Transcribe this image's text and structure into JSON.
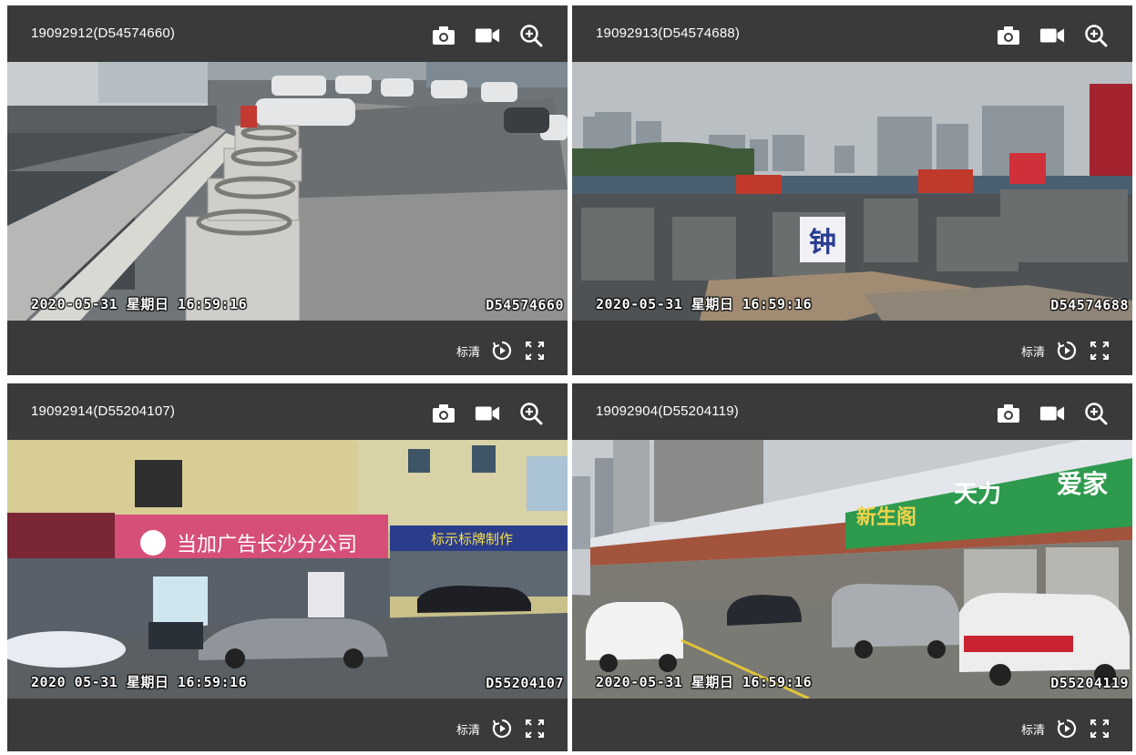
{
  "toolbar": {
    "snapshot_icon": "camera-icon",
    "record_icon": "video-camera-icon",
    "zoom_icon": "zoom-in-icon",
    "play_icon": "play-circle-icon",
    "fullscreen_icon": "fullscreen-icon"
  },
  "cameras": [
    {
      "title": "19092912(D54574660)",
      "osd_date": "2020-05-31 星期日 16:59:16",
      "osd_id": "D54574660",
      "quality": "标清"
    },
    {
      "title": "19092913(D54574688)",
      "osd_date": "2020-05-31 星期日 16:59:16",
      "osd_id": "D54574688",
      "quality": "标清"
    },
    {
      "title": "19092914(D55204107)",
      "osd_date": "2020 05-31 星期日 16:59:16",
      "osd_id": "D55204107",
      "quality": "标清"
    },
    {
      "title": "19092904(D55204119)",
      "osd_date": "2020-05-31 星期日 16:59:16",
      "osd_id": "D55204119",
      "quality": "标清"
    }
  ],
  "signs": {
    "cam1_board": "钟",
    "cam2_sign": "当加广告长沙分公司",
    "cam2_sign2": "标示标牌制作",
    "cam3_sign": "天力",
    "cam3_sign2": "爱家",
    "cam3_sign3": "新生阁"
  },
  "colors": {
    "panel_bg": "#3a3a3a",
    "text": "#ffffff",
    "page_bg": "#ffffff"
  }
}
